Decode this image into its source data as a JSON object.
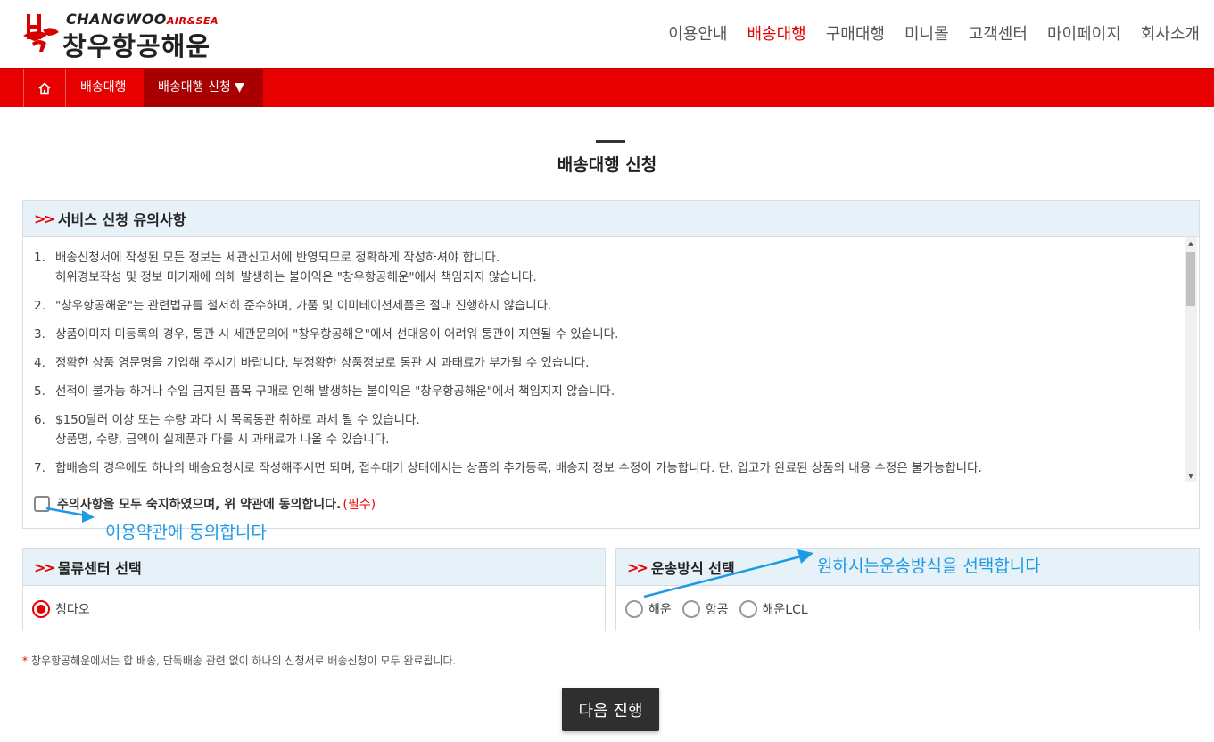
{
  "header": {
    "logo_en": "CHANGWOO",
    "logo_en_sub": "AIR&SEA",
    "logo_ko": "창우항공해운",
    "nav": [
      {
        "label": "이용안내",
        "active": false
      },
      {
        "label": "배송대행",
        "active": true
      },
      {
        "label": "구매대행",
        "active": false
      },
      {
        "label": "미니몰",
        "active": false
      },
      {
        "label": "고객센터",
        "active": false
      },
      {
        "label": "마이페이지",
        "active": false
      },
      {
        "label": "회사소개",
        "active": false
      }
    ]
  },
  "breadcrumb": {
    "home_icon": "home-icon",
    "level1": "배송대행",
    "level2": "배송대행 신청 ▼"
  },
  "page": {
    "title": "배송대행 신청"
  },
  "notice": {
    "heading": "서비스 신청 유의사항",
    "items": [
      {
        "num": "1.",
        "line1": "배송신청서에 작성된 모든 정보는 세관신고서에 반영되므로 정확하게 작성하셔야 합니다.",
        "line2": "허위경보작성 및 정보 미기재에 의해 발생하는 불이익은 \"창우항공해운\"에서 책임지지 않습니다."
      },
      {
        "num": "2.",
        "line1": "\"창우항공해운\"는 관련법규를 철저히 준수하며, 가품 및 이미테이션제품은 절대 진행하지 않습니다.",
        "line2": ""
      },
      {
        "num": "3.",
        "line1": "상품이미지 미등록의 경우, 통관 시 세관문의에 \"창우항공해운\"에서 선대응이 어려워 통관이 지연될 수 있습니다.",
        "line2": ""
      },
      {
        "num": "4.",
        "line1": "정확한 상품 영문명을 기입해 주시기 바랍니다. 부정확한 상품정보로 통관 시 과태료가 부가될 수 있습니다.",
        "line2": ""
      },
      {
        "num": "5.",
        "line1": "선적이 불가능 하거나 수입 금지된 품목 구매로 인해 발생하는 불이익은 \"창우항공해운\"에서 책임지지 않습니다.",
        "line2": ""
      },
      {
        "num": "6.",
        "line1": "$150달러 이상 또는 수량 과다 시 목록통관 취하로 과세 될 수 있습니다.",
        "line2": "상품명, 수량, 금액이 실제품과 다를 시 과태료가 나올 수 있습니다."
      },
      {
        "num": "7.",
        "line1": "합배송의 경우에도 하나의 배송요청서로 작성해주시면 되며, 접수대기 상태에서는 상품의 추가등록, 배송지 정보 수정이 가능합니다. 단, 입고가 완료된 상품의 내용 수정은 불가능합니다.",
        "line2": ""
      }
    ],
    "agree_label": "주의사항을 모두 숙지하였으며, 위 약관에 동의합니다.",
    "agree_required": "(필수)"
  },
  "center": {
    "heading": "물류센터 선택",
    "options": [
      {
        "label": "칭다오",
        "checked": true
      }
    ]
  },
  "shipping": {
    "heading": "운송방식 선택",
    "options": [
      {
        "label": "해운",
        "checked": false
      },
      {
        "label": "항공",
        "checked": false
      },
      {
        "label": "해운LCL",
        "checked": false
      }
    ]
  },
  "footnote": {
    "star": "*",
    "text": "창우항공해운에서는 합 배송, 단독배송 관련 없이 하나의 신청서로 배송신청이 모두 완료됩니다."
  },
  "next_button": "다음 진행",
  "annotations": {
    "agree_hint": "이용약관에 동의합니다",
    "shipping_hint": "원하시는운송방식을 선택합니다",
    "color": "#1e9be6"
  },
  "colors": {
    "brand_red": "#e60000",
    "subnav_active": "#a80000",
    "section_head_bg": "#e7f1f8",
    "button_dark": "#2f2f2f"
  }
}
